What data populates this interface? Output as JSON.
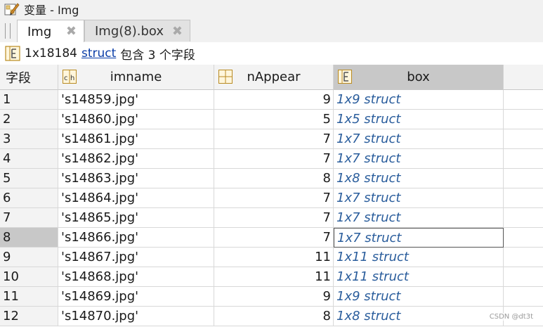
{
  "window": {
    "title": "变量 - Img"
  },
  "tabs": [
    {
      "label": "Img",
      "active": true
    },
    {
      "label": "Img(8).box",
      "active": false
    }
  ],
  "close_glyph": "✖",
  "info": {
    "dims": "1x18184",
    "link": "struct",
    "suffix": "包含 3 个字段"
  },
  "columns": {
    "rowheader": "字段",
    "imname": "imname",
    "nAppear": "nAppear",
    "box": "box"
  },
  "rows": [
    {
      "n": "1",
      "imname": "'s14859.jpg'",
      "nAppear": "9",
      "box": "1x9 struct"
    },
    {
      "n": "2",
      "imname": "'s14860.jpg'",
      "nAppear": "5",
      "box": "1x5 struct"
    },
    {
      "n": "3",
      "imname": "'s14861.jpg'",
      "nAppear": "7",
      "box": "1x7 struct"
    },
    {
      "n": "4",
      "imname": "'s14862.jpg'",
      "nAppear": "7",
      "box": "1x7 struct"
    },
    {
      "n": "5",
      "imname": "'s14863.jpg'",
      "nAppear": "8",
      "box": "1x8 struct"
    },
    {
      "n": "6",
      "imname": "'s14864.jpg'",
      "nAppear": "7",
      "box": "1x7 struct"
    },
    {
      "n": "7",
      "imname": "'s14865.jpg'",
      "nAppear": "7",
      "box": "1x7 struct"
    },
    {
      "n": "8",
      "imname": "'s14866.jpg'",
      "nAppear": "7",
      "box": "1x7 struct"
    },
    {
      "n": "9",
      "imname": "'s14867.jpg'",
      "nAppear": "11",
      "box": "1x11 struct"
    },
    {
      "n": "10",
      "imname": "'s14868.jpg'",
      "nAppear": "11",
      "box": "1x11 struct"
    },
    {
      "n": "11",
      "imname": "'s14869.jpg'",
      "nAppear": "9",
      "box": "1x9 struct"
    },
    {
      "n": "12",
      "imname": "'s14870.jpg'",
      "nAppear": "8",
      "box": "1x8 struct"
    }
  ],
  "selected_row": "8",
  "watermark": "CSDN @dt3t",
  "colors": {
    "struct_text": "#2a5d9c",
    "link": "#0b3ea8",
    "selected": "#c8c8c8"
  },
  "icons": {
    "title": "variable-edit-icon",
    "info": "struct-icon",
    "imname": "char-column-icon",
    "nAppear": "numeric-column-icon",
    "box": "struct-column-icon"
  }
}
